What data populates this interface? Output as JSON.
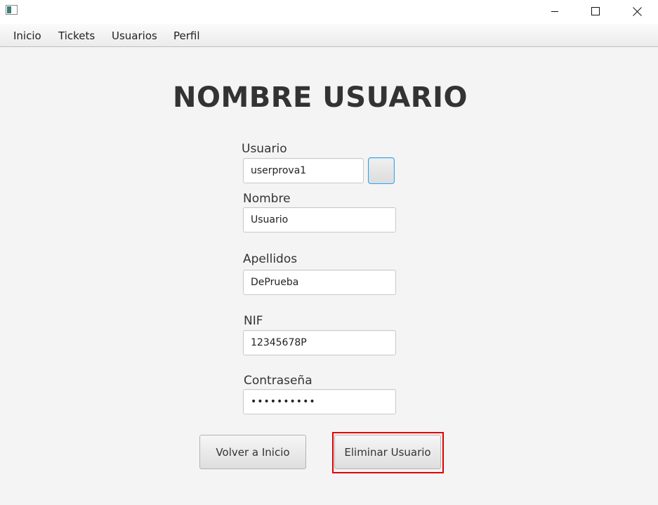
{
  "window": {
    "icon": "app-window-icon",
    "controls": {
      "minimize_icon": "minimize-icon",
      "maximize_icon": "maximize-icon",
      "close_icon": "close-icon"
    }
  },
  "menubar": {
    "items": [
      {
        "label": "Inicio"
      },
      {
        "label": "Tickets"
      },
      {
        "label": "Usuarios"
      },
      {
        "label": "Perfil"
      }
    ]
  },
  "page": {
    "title": "NOMBRE USUARIO"
  },
  "form": {
    "usuario": {
      "label": "Usuario",
      "value": "userprova1"
    },
    "nombre": {
      "label": "Nombre",
      "value": "Usuario"
    },
    "apellidos": {
      "label": "Apellidos",
      "value": "DePrueba"
    },
    "nif": {
      "label": "NIF",
      "value": "12345678P"
    },
    "contrasena": {
      "label": "Contraseña",
      "value": "••••••••••"
    }
  },
  "buttons": {
    "volver": "Volver a Inicio",
    "eliminar": "Eliminar Usuario"
  },
  "colors": {
    "highlight": "#e00000",
    "focus_border": "#3aa0e0"
  }
}
